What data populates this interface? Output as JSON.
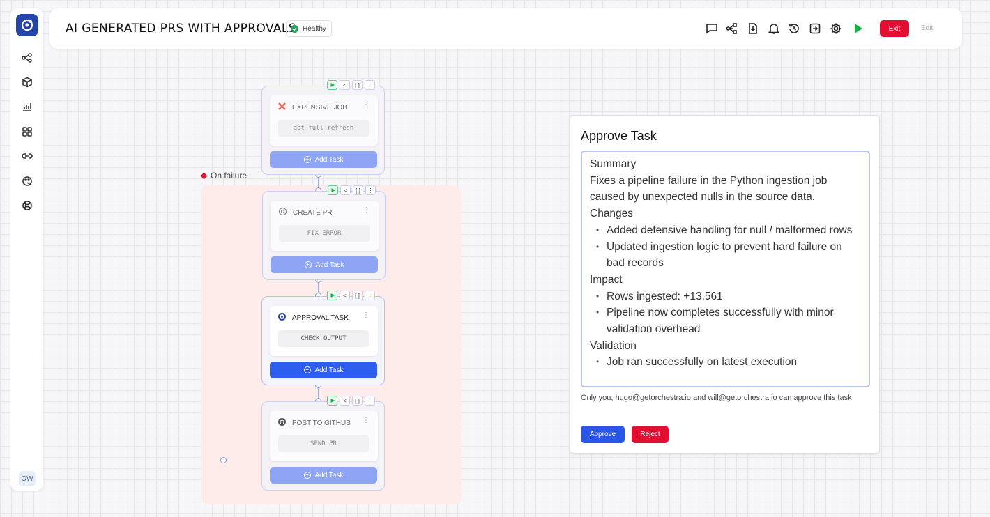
{
  "header": {
    "title": "AI GENERATED PRS WITH APPROVALS",
    "status": "Healthy",
    "toolbar": [
      "chat-icon",
      "graph-icon",
      "download-icon",
      "bell-icon",
      "history-icon",
      "export-icon",
      "settings-icon",
      "run-icon"
    ],
    "exit_label": "Exit",
    "edit_label": "Edit"
  },
  "sidebar": {
    "items": [
      "pipelines-icon",
      "packages-icon",
      "charts-icon",
      "grid-icon",
      "links-icon",
      "palette-icon",
      "integrations-icon"
    ],
    "avatar": "OW"
  },
  "canvas": {
    "failure_label": "On failure",
    "nodes": [
      {
        "title": "EXPENSIVE JOB",
        "command": "dbt full refresh",
        "icon": "dbt-icon",
        "add_label": "Add Task"
      },
      {
        "title": "CREATE PR",
        "command": "FIX ERROR",
        "icon": "openai-icon",
        "add_label": "Add Task"
      },
      {
        "title": "APPROVAL TASK",
        "command": "CHECK OUTPUT",
        "icon": "orchestra-icon",
        "add_label": "Add Task"
      },
      {
        "title": "POST TO GITHUB",
        "command": "SEND PR",
        "icon": "github-icon",
        "add_label": "Add Task"
      }
    ]
  },
  "approval": {
    "title": "Approve Task",
    "summary_heading": "Summary",
    "summary_text": " Fixes a pipeline failure in the Python ingestion job caused by unexpected nulls in the source data.",
    "changes_heading": "Changes",
    "changes": [
      "Added defensive handling for null / malformed rows",
      "Updated ingestion logic to prevent hard failure on bad records"
    ],
    "impact_heading": "Impact",
    "impact": [
      "Rows ingested: +13,561",
      "Pipeline now completes successfully with minor validation overhead"
    ],
    "validation_heading": "Validation",
    "validation": [
      "Job ran successfully on latest execution"
    ],
    "note": "Only you, hugo@getorchestra.io and will@getorchestra.io can approve this task",
    "approve_label": "Approve",
    "reject_label": "Reject"
  }
}
